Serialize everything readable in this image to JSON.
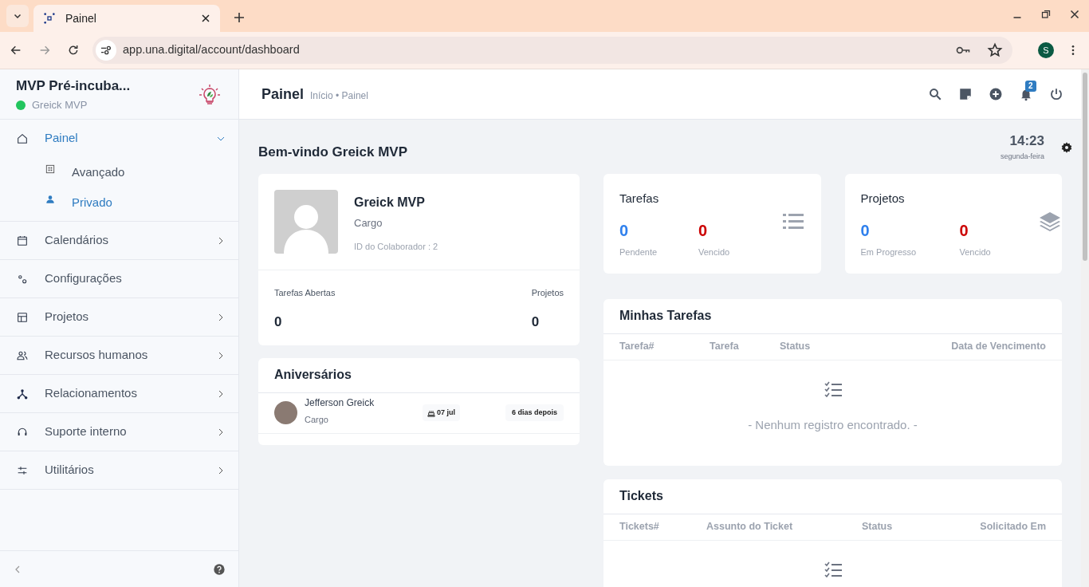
{
  "browser": {
    "tab_title": "Painel",
    "url": "app.una.digital/account/dashboard",
    "profile_initial": "S"
  },
  "sidebar": {
    "org_name": "MVP Pré-incuba...",
    "user": "Greick MVP",
    "online": true,
    "items": [
      {
        "label": "Painel",
        "selected": true,
        "expanded": true,
        "has_submenu": true,
        "children": [
          {
            "label": "Avançado",
            "selected": false
          },
          {
            "label": "Privado",
            "selected": true
          }
        ]
      },
      {
        "label": "Calendários",
        "selected": false,
        "expanded": false,
        "has_submenu": true
      },
      {
        "label": "Configurações",
        "selected": false,
        "has_submenu": false
      },
      {
        "label": "Projetos",
        "selected": false,
        "expanded": false,
        "has_submenu": true
      },
      {
        "label": "Recursos humanos",
        "selected": false,
        "expanded": false,
        "has_submenu": true
      },
      {
        "label": "Relacionamentos",
        "selected": false,
        "expanded": false,
        "has_submenu": true
      },
      {
        "label": "Suporte interno",
        "selected": false,
        "expanded": false,
        "has_submenu": true
      },
      {
        "label": "Utilitários",
        "selected": false,
        "expanded": false,
        "has_submenu": true
      }
    ]
  },
  "header": {
    "title": "Painel",
    "breadcrumb": "Início • Painel",
    "notification_count": "2"
  },
  "welcome": "Bem-vindo Greick MVP",
  "clock": {
    "time": "14:23",
    "day": "segunda-feira"
  },
  "profile": {
    "name": "Greick MVP",
    "role": "Cargo",
    "employee_id": "ID do Colaborador : 2",
    "stats": [
      {
        "label": "Tarefas Abertas",
        "value": "0"
      },
      {
        "label": "Projetos",
        "value": "0"
      }
    ]
  },
  "birthdays": {
    "title": "Aniversários",
    "entries": [
      {
        "name": "Jefferson Greick",
        "role": "Cargo",
        "date": "07 jul",
        "relative": "6 dias depois"
      }
    ]
  },
  "summary_cards": [
    {
      "title": "Tarefas",
      "kind": "list",
      "metrics": [
        {
          "value": "0",
          "label": "Pendente",
          "color": "#2f80ed"
        },
        {
          "value": "0",
          "label": "Vencido",
          "color": "#cc0000"
        }
      ]
    },
    {
      "title": "Projetos",
      "kind": "layers",
      "metrics": [
        {
          "value": "0",
          "label": "Em Progresso",
          "color": "#2f80ed"
        },
        {
          "value": "0",
          "label": "Vencido",
          "color": "#cc0000"
        }
      ]
    }
  ],
  "tables": [
    {
      "title": "Minhas Tarefas",
      "columns": [
        "Tarefa#",
        "Tarefa",
        "Status",
        "Data de Vencimento"
      ],
      "empty_message": "- Nenhum registro encontrado. -"
    },
    {
      "title": "Tickets",
      "columns": [
        "Tickets#",
        "Assunto do Ticket",
        "Status",
        "Solicitado Em"
      ]
    }
  ]
}
